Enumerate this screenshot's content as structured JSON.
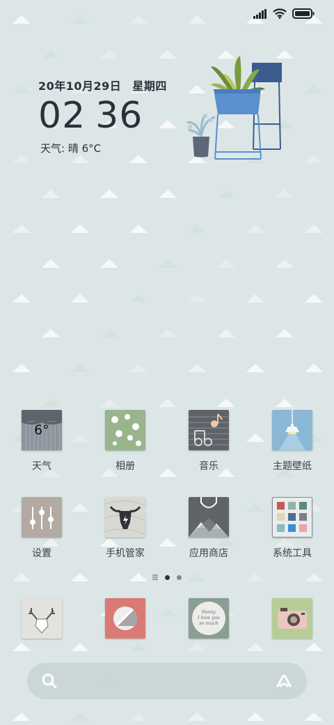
{
  "clock": {
    "date": "20年10月29日",
    "weekday": "星期四",
    "hours": "02",
    "minutes": "36",
    "weather_label": "天气:",
    "weather_condition": "晴",
    "temperature": "6°C"
  },
  "apps_row1": [
    {
      "label": "天气",
      "icon": "weather-icon",
      "icon_text": "6°"
    },
    {
      "label": "相册",
      "icon": "gallery-icon"
    },
    {
      "label": "音乐",
      "icon": "music-icon"
    },
    {
      "label": "主题壁纸",
      "icon": "themes-icon"
    }
  ],
  "apps_row2": [
    {
      "label": "设置",
      "icon": "settings-icon"
    },
    {
      "label": "手机管家",
      "icon": "security-icon"
    },
    {
      "label": "应用商店",
      "icon": "app-store-icon"
    },
    {
      "label": "系统工具",
      "icon": "tools-icon"
    }
  ],
  "dock": [
    {
      "icon": "deer-icon"
    },
    {
      "icon": "browser-icon"
    },
    {
      "icon": "notes-icon",
      "note_lines": [
        "Penny",
        "I love you",
        "so much"
      ]
    },
    {
      "icon": "camera-icon"
    }
  ],
  "page_indicator": {
    "pages": 2,
    "current": 1
  },
  "colors": {
    "background": "#dde6e7",
    "text": "#2b313a"
  }
}
